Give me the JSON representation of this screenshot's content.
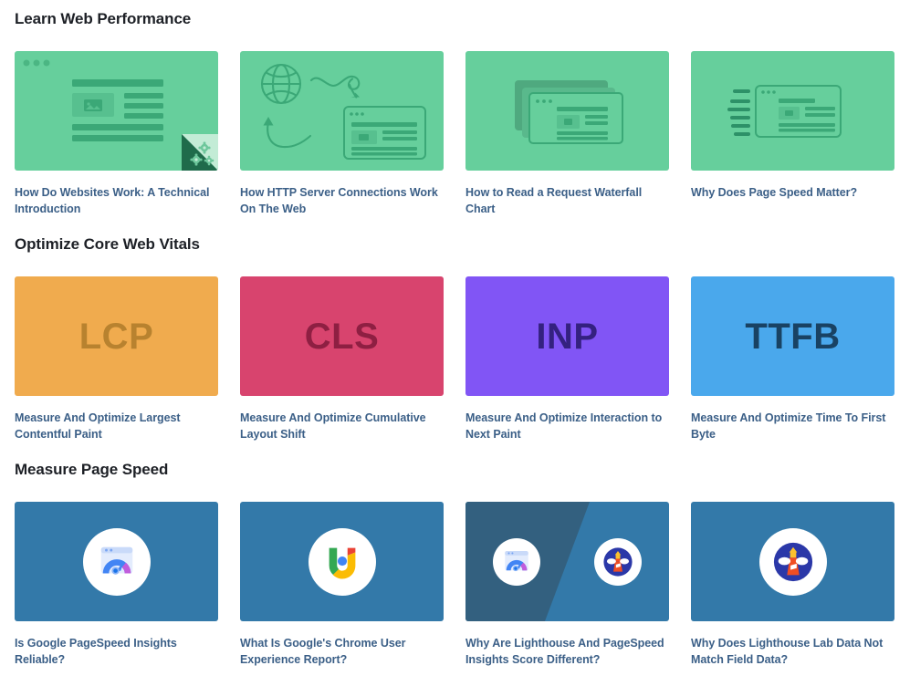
{
  "page": {
    "background": "#ffffff",
    "link_color": "#3b5f87",
    "heading_color": "#1d2026"
  },
  "sections": [
    {
      "id": "learn-web-performance",
      "title": "Learn Web Performance",
      "cards": [
        {
          "title": "How Do Websites Work: A Technical Introduction",
          "thumb_type": "browser-wireframe",
          "thumb_icon": "browser-window-icon",
          "bg": "#66cf9c",
          "accent": "#4bb683",
          "corner_fold": true
        },
        {
          "title": "How HTTP Server Connections Work On The Web",
          "thumb_type": "globe-request-flow",
          "thumb_icon": "globe-icon",
          "bg": "#66cf9c",
          "accent": "#4bb683",
          "corner_fold": false
        },
        {
          "title": "How to Read a Request Waterfall Chart",
          "thumb_type": "stacked-windows",
          "thumb_icon": "stacked-windows-icon",
          "bg": "#66cf9c",
          "accent": "#4bb683",
          "corner_fold": false
        },
        {
          "title": "Why Does Page Speed Matter?",
          "thumb_type": "speed-lines-window",
          "thumb_icon": "speed-lines-icon",
          "bg": "#66cf9c",
          "accent": "#4bb683",
          "corner_fold": false
        }
      ]
    },
    {
      "id": "optimize-core-web-vitals",
      "title": "Optimize Core Web Vitals",
      "cards": [
        {
          "title": "Measure And Optimize Largest Contentful Paint",
          "thumb_type": "acronym",
          "acronym": "LCP",
          "bg": "#f0ab4e",
          "accent": "#b8822f"
        },
        {
          "title": "Measure And Optimize Cumulative Layout Shift",
          "thumb_type": "acronym",
          "acronym": "CLS",
          "bg": "#d8446e",
          "accent": "#8e1f42"
        },
        {
          "title": "Measure And Optimize Interaction to Next Paint",
          "thumb_type": "acronym",
          "acronym": "INP",
          "bg": "#8155f5",
          "accent": "#342180"
        },
        {
          "title": "Measure And Optimize Time To First Byte",
          "thumb_type": "acronym",
          "acronym": "TTFB",
          "bg": "#4aa8ec",
          "accent": "#194263"
        }
      ]
    },
    {
      "id": "measure-page-speed",
      "title": "Measure Page Speed",
      "cards": [
        {
          "title": "Is Google PageSpeed Insights Reliable?",
          "thumb_type": "logo-single",
          "thumb_icon": "pagespeed-insights-logo",
          "bg": "#3379a9"
        },
        {
          "title": "What Is Google's Chrome User Experience Report?",
          "thumb_type": "logo-single",
          "thumb_icon": "crux-logo",
          "bg": "#3379a9"
        },
        {
          "title": "Why Are Lighthouse And PageSpeed Insights Score Different?",
          "thumb_type": "logo-split",
          "thumb_icon": "pagespeed-insights-logo + lighthouse-logo",
          "bg": "#3379a9",
          "bg_left": "#33607f"
        },
        {
          "title": "Why Does Lighthouse Lab Data Not Match Field Data?",
          "thumb_type": "logo-single",
          "thumb_icon": "lighthouse-logo",
          "bg": "#3379a9"
        }
      ]
    }
  ],
  "logo_colors": {
    "google_blue": "#4285f4",
    "google_red": "#ea4335",
    "google_yellow": "#fbbc04",
    "google_green": "#34a853",
    "lighthouse_blue": "#2b38a8",
    "lighthouse_orange": "#f04e23",
    "lighthouse_yellow": "#fbc02d",
    "pagespeed_purple": "#c15ddc"
  }
}
